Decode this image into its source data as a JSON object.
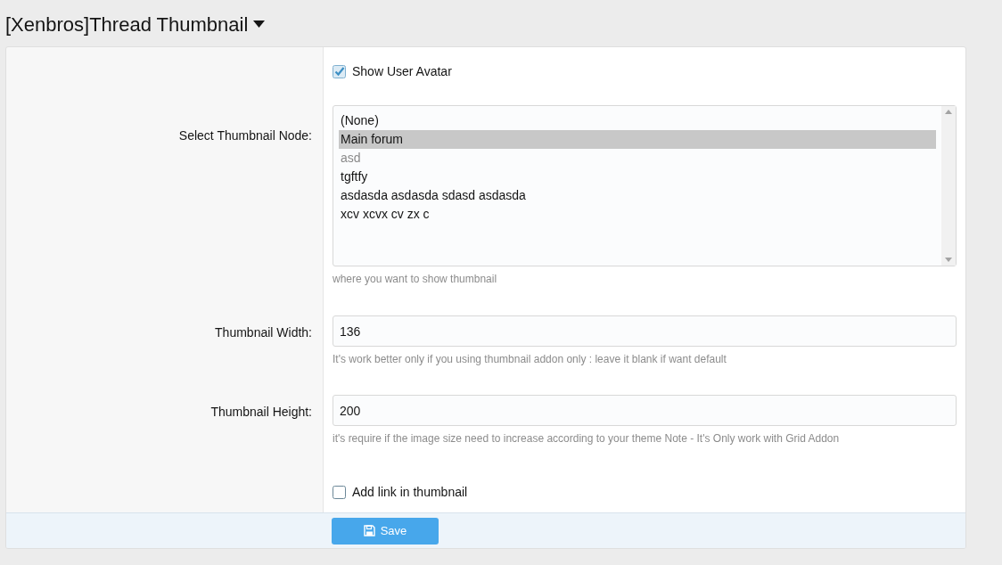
{
  "title": "[Xenbros]Thread Thumbnail",
  "rows": [
    {
      "kind": "checkbox",
      "label": "Show User Avatar",
      "checked": true
    },
    {
      "kind": "listbox",
      "label": "Select Thumbnail Node:",
      "hint": "where you want to show thumbnail",
      "options": [
        {
          "label": "(None)",
          "selected": false,
          "disabled": false
        },
        {
          "label": "Main forum",
          "selected": true,
          "disabled": false
        },
        {
          "label": "asd",
          "selected": false,
          "disabled": true
        },
        {
          "label": "tgftfy",
          "selected": false,
          "disabled": false
        },
        {
          "label": "asdasda asdasda sdasd asdasda",
          "selected": false,
          "disabled": false
        },
        {
          "label": "xcv xcvx cv zx c",
          "selected": false,
          "disabled": false
        }
      ]
    },
    {
      "kind": "text",
      "label": "Thumbnail Width:",
      "value": "136",
      "hint": "It's work better only if you using thumbnail addon only : leave it blank if want default"
    },
    {
      "kind": "text",
      "label": "Thumbnail Height:",
      "value": "200",
      "hint": "it's require if the image size need to increase according to your theme Note - It's Only work with Grid Addon"
    },
    {
      "kind": "checkbox",
      "label": "Add link in thumbnail",
      "checked": false
    }
  ],
  "save_button": "Save"
}
